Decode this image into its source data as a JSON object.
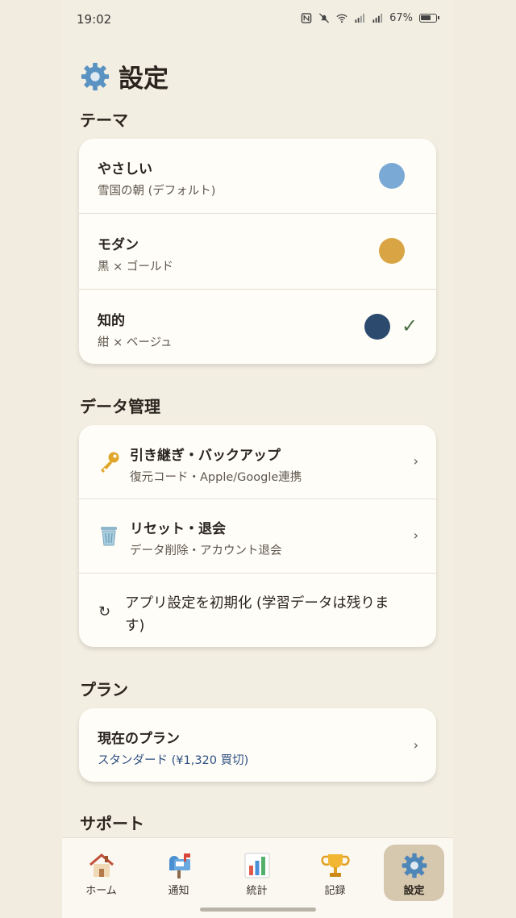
{
  "status_bar": {
    "time": "19:02",
    "battery": "67%",
    "icons": [
      "nfc-icon",
      "mute-icon",
      "wifi-icon",
      "signal-icon",
      "signal-icon",
      "battery-icon"
    ]
  },
  "page": {
    "title": "設定",
    "title_icon": "gear-icon"
  },
  "theme_section": {
    "heading": "テーマ",
    "items": [
      {
        "title": "やさしい",
        "subtitle": "雪国の朝 (デフォルト)",
        "color": "#7aa9d6",
        "selected": false
      },
      {
        "title": "モダン",
        "subtitle": "黒 × ゴールド",
        "color": "#d9a443",
        "selected": false
      },
      {
        "title": "知的",
        "subtitle": "紺 × ベージュ",
        "color": "#2c4a6e",
        "selected": true,
        "check_mark": "✓"
      }
    ]
  },
  "data_section": {
    "heading": "データ管理",
    "items": [
      {
        "icon": "key-icon",
        "title": "引き継ぎ・バックアップ",
        "subtitle": "復元コード・Apple/Google連携",
        "chevron": "›"
      },
      {
        "icon": "trash-icon",
        "title": "リセット・退会",
        "subtitle": "データ削除・アカウント退会",
        "chevron": "›"
      },
      {
        "icon": "reset-icon",
        "icon_glyph": "↻",
        "title_line1": "アプリ設定を初期化 (学習データは残りま",
        "title_line2": "す)"
      }
    ]
  },
  "plan_section": {
    "heading": "プラン",
    "current_label": "現在のプラン",
    "current_value": "スタンダード (¥1,320 買切)",
    "chevron": "›",
    "value_color": "#2e4f82"
  },
  "support_section": {
    "heading": "サポート"
  },
  "bottom_nav": {
    "items": [
      {
        "label": "ホーム",
        "icon": "house-icon",
        "active": false
      },
      {
        "label": "通知",
        "icon": "mailbox-icon",
        "active": false
      },
      {
        "label": "統計",
        "icon": "bar-chart-icon",
        "active": false
      },
      {
        "label": "記録",
        "icon": "trophy-icon",
        "active": false
      },
      {
        "label": "設定",
        "icon": "gear-icon",
        "active": true
      }
    ]
  },
  "colors": {
    "background": "#f3eee2",
    "card": "#fffdf7",
    "accent_active_nav": "#d6c8ae",
    "check": "#4c6e45"
  }
}
